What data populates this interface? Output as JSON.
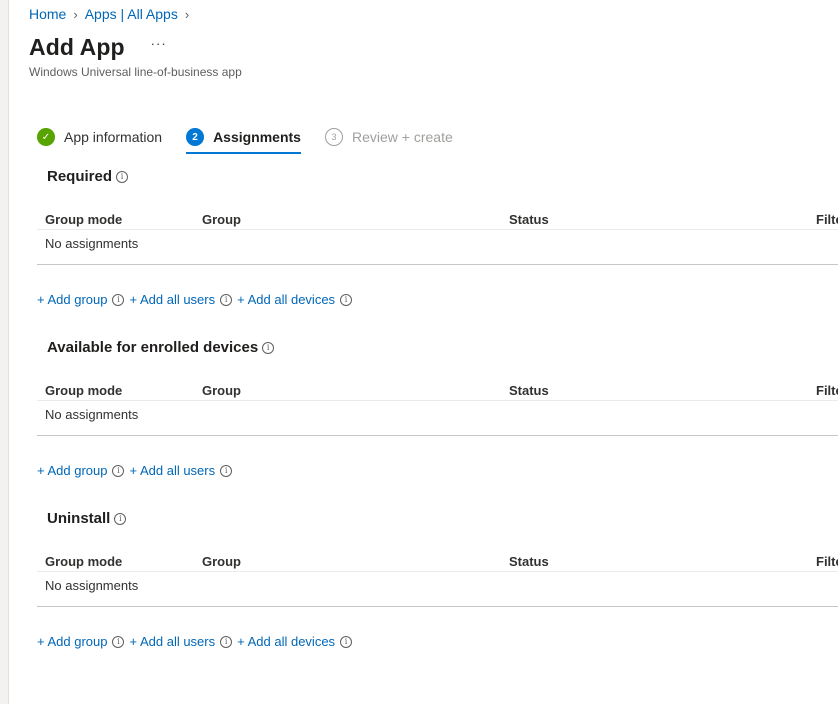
{
  "breadcrumb": {
    "home": "Home",
    "apps": "Apps | All Apps"
  },
  "header": {
    "title": "Add App",
    "more": "···",
    "subtitle": "Windows Universal line-of-business app"
  },
  "steps": [
    {
      "number": "✓",
      "label": "App information",
      "state": "done"
    },
    {
      "number": "2",
      "label": "Assignments",
      "state": "active"
    },
    {
      "number": "3",
      "label": "Review + create",
      "state": "pending"
    }
  ],
  "columns": {
    "mode": "Group mode",
    "group": "Group",
    "status": "Status",
    "filter": "Filte"
  },
  "sections": {
    "required": {
      "title": "Required",
      "empty": "No assignments",
      "add_group": "+ Add group",
      "add_all_users": "+ Add all users",
      "add_all_devices": "+ Add all devices"
    },
    "available": {
      "title": "Available for enrolled devices",
      "empty": "No assignments",
      "add_group": "+ Add group",
      "add_all_users": "+ Add all users"
    },
    "uninstall": {
      "title": "Uninstall",
      "empty": "No assignments",
      "add_group": "+ Add group",
      "add_all_users": "+ Add all users",
      "add_all_devices": "+ Add all devices"
    }
  },
  "colors": {
    "link": "#0067b8",
    "accent": "#0078d4",
    "success": "#57a300"
  }
}
